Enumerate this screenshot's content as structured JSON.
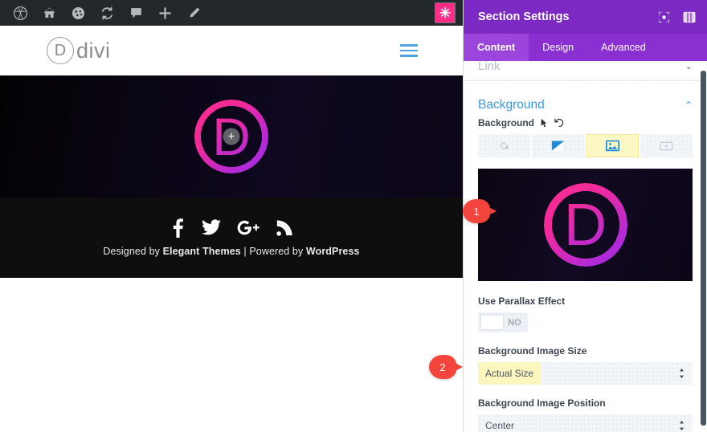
{
  "adminbar": {
    "items": [
      {
        "name": "wordpress-logo-icon",
        "label": "W"
      },
      {
        "name": "site-home-icon",
        "label": "Home"
      },
      {
        "name": "dashboard-speed-icon",
        "label": "Dashboard"
      },
      {
        "name": "updates-icon",
        "label": "Updates"
      },
      {
        "name": "comments-icon",
        "label": "Comments"
      },
      {
        "name": "new-content-icon",
        "label": "New"
      },
      {
        "name": "edit-page-icon",
        "label": "Edit"
      }
    ],
    "flag_glyph": "✳"
  },
  "site": {
    "logo_mark": "D",
    "logo_text": "divi",
    "menu_icon": "hamburger-menu-icon",
    "hero": {
      "logo_letter": "D",
      "add_button_glyph": "+"
    },
    "footer": {
      "social": [
        {
          "name": "facebook-icon",
          "glyph": "f"
        },
        {
          "name": "twitter-icon",
          "glyph": "t"
        },
        {
          "name": "google-plus-icon",
          "glyph": "G+"
        },
        {
          "name": "rss-icon",
          "glyph": "rss"
        }
      ],
      "credit_prefix": "Designed by ",
      "credit_brand": "Elegant Themes",
      "credit_sep": " | ",
      "credit_powered": "Powered by ",
      "credit_platform": "WordPress"
    }
  },
  "panel": {
    "title": "Section Settings",
    "head_icons": [
      {
        "name": "focus-target-icon"
      },
      {
        "name": "panel-layout-icon"
      }
    ],
    "tabs": [
      {
        "label": "Content",
        "active": true
      },
      {
        "label": "Design",
        "active": false
      },
      {
        "label": "Advanced",
        "active": false
      }
    ],
    "link_section": {
      "label": "Link",
      "chevron": "⌄"
    },
    "background_section": {
      "title": "Background",
      "chevron": "⌃",
      "field_label": "Background",
      "types": [
        {
          "name": "background-color-tab",
          "label": "Background Color",
          "active": false
        },
        {
          "name": "background-gradient-tab",
          "label": "Background Gradient",
          "active": false
        },
        {
          "name": "background-image-tab",
          "label": "Background Image",
          "active": true
        },
        {
          "name": "background-video-tab",
          "label": "Background Video",
          "active": false
        }
      ],
      "preview_letter": "D"
    },
    "parallax": {
      "label": "Use Parallax Effect",
      "value": "NO"
    },
    "image_size": {
      "label": "Background Image Size",
      "value": "Actual Size"
    },
    "image_position": {
      "label": "Background Image Position",
      "value": "Center"
    }
  },
  "callouts": [
    {
      "number": "1"
    },
    {
      "number": "2"
    }
  ],
  "colors": {
    "panel_purple": "#7d29c4",
    "tab_purple": "#8a2fd2",
    "accent_blue": "#3b9ae1",
    "callout_red": "#f4453c",
    "highlight_yellow": "#fbf6bd",
    "admin_dark": "#23282d",
    "pink": "#ff2d8f"
  }
}
